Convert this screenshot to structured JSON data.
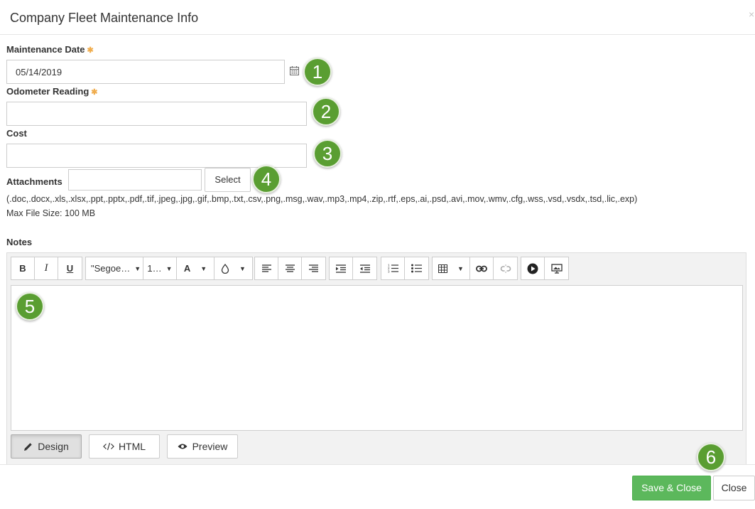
{
  "dialog": {
    "title": "Company Fleet Maintenance Info",
    "close_symbol": "×"
  },
  "fields": {
    "maintenance_date": {
      "label": "Maintenance Date",
      "required_mark": "✱",
      "value": "05/14/2019"
    },
    "odometer": {
      "label": "Odometer Reading",
      "required_mark": "✱",
      "value": ""
    },
    "cost": {
      "label": "Cost",
      "value": ""
    },
    "attachments": {
      "label": "Attachments",
      "value": "",
      "select_label": "Select",
      "allowed_types": "(.doc,.docx,.xls,.xlsx,.ppt,.pptx,.pdf,.tif,.jpeg,.jpg,.gif,.bmp,.txt,.csv,.png,.msg,.wav,.mp3,.mp4,.zip,.rtf,.eps,.ai,.psd,.avi,.mov,.wmv,.cfg,.wss,.vsd,.vsdx,.tsd,.lic,.exp)",
      "max_size": "Max File Size: 100 MB"
    },
    "notes": {
      "label": "Notes"
    }
  },
  "toolbar": {
    "bold": "B",
    "italic": "I",
    "underline": "U",
    "font_name": "\"Segoe…",
    "font_size": "1…",
    "font_color": "A"
  },
  "editor_modes": {
    "design": "Design",
    "html": "HTML",
    "preview": "Preview"
  },
  "buttons": {
    "save_close": "Save & Close",
    "close": "Close"
  },
  "badges": [
    "1",
    "2",
    "3",
    "4",
    "5",
    "6"
  ],
  "colors": {
    "badge_green": "#5a9e32",
    "primary_green": "#5cb85c",
    "required_orange": "#f0ad4e"
  }
}
